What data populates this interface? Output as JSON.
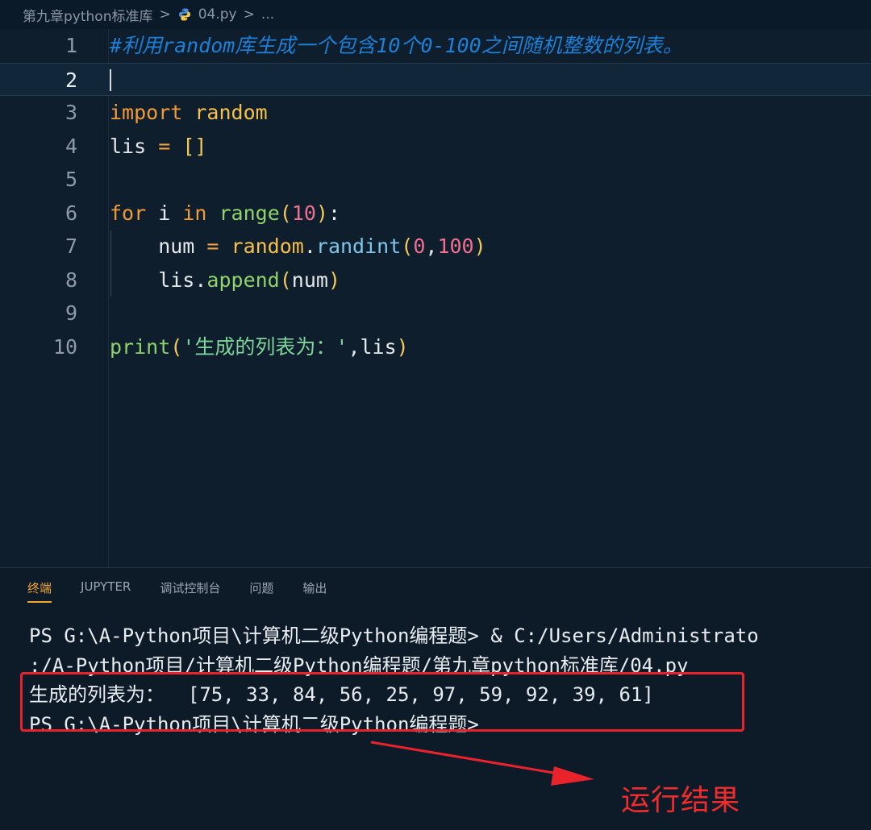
{
  "breadcrumb": {
    "folder": "第九章python标准库",
    "separator": ">",
    "file": "04.py",
    "more": "...",
    "file_icon": "python-file-icon"
  },
  "editor": {
    "current_line": 2,
    "lines": [
      {
        "number": "1",
        "tokens": [
          {
            "t": "#利用random库生成一个包含10个0-100之间随机整数的列表。",
            "c": "comment"
          }
        ]
      },
      {
        "number": "2",
        "tokens": []
      },
      {
        "number": "3",
        "tokens": [
          {
            "t": "import",
            "c": "kw"
          },
          {
            "t": " ",
            "c": "var"
          },
          {
            "t": "random",
            "c": "mod"
          }
        ]
      },
      {
        "number": "4",
        "tokens": [
          {
            "t": "lis",
            "c": "var"
          },
          {
            "t": " = ",
            "c": "op"
          },
          {
            "t": "[]",
            "c": "brk"
          }
        ]
      },
      {
        "number": "5",
        "tokens": []
      },
      {
        "number": "6",
        "tokens": [
          {
            "t": "for",
            "c": "kw"
          },
          {
            "t": " i ",
            "c": "var"
          },
          {
            "t": "in",
            "c": "kw"
          },
          {
            "t": " ",
            "c": "var"
          },
          {
            "t": "range",
            "c": "func"
          },
          {
            "t": "(",
            "c": "brk"
          },
          {
            "t": "10",
            "c": "num"
          },
          {
            "t": ")",
            "c": "brk"
          },
          {
            "t": ":",
            "c": "punc"
          }
        ]
      },
      {
        "number": "7",
        "tokens": [
          {
            "t": "    num",
            "c": "var"
          },
          {
            "t": " = ",
            "c": "op"
          },
          {
            "t": "random",
            "c": "mod"
          },
          {
            "t": ".",
            "c": "punc"
          },
          {
            "t": "randint",
            "c": "method"
          },
          {
            "t": "(",
            "c": "brk"
          },
          {
            "t": "0",
            "c": "num"
          },
          {
            "t": ",",
            "c": "punc"
          },
          {
            "t": "100",
            "c": "num"
          },
          {
            "t": ")",
            "c": "brk"
          }
        ]
      },
      {
        "number": "8",
        "tokens": [
          {
            "t": "    lis",
            "c": "var"
          },
          {
            "t": ".",
            "c": "punc"
          },
          {
            "t": "append",
            "c": "func"
          },
          {
            "t": "(",
            "c": "brk"
          },
          {
            "t": "num",
            "c": "var"
          },
          {
            "t": ")",
            "c": "brk"
          }
        ]
      },
      {
        "number": "9",
        "tokens": []
      },
      {
        "number": "10",
        "tokens": [
          {
            "t": "print",
            "c": "func"
          },
          {
            "t": "(",
            "c": "brk"
          },
          {
            "t": "'生成的列表为：'",
            "c": "str"
          },
          {
            "t": ",",
            "c": "punc"
          },
          {
            "t": "lis",
            "c": "var"
          },
          {
            "t": ")",
            "c": "brk"
          }
        ]
      }
    ]
  },
  "panel": {
    "tabs": [
      {
        "label": "终端",
        "active": true
      },
      {
        "label": "JUPYTER",
        "active": false
      },
      {
        "label": "调试控制台",
        "active": false
      },
      {
        "label": "问题",
        "active": false
      },
      {
        "label": "输出",
        "active": false
      }
    ],
    "terminal_lines": [
      "PS G:\\A-Python项目\\计算机二级Python编程题> & C:/Users/Administrato",
      ":/A-Python项目/计算机二级Python编程题/第九章python标准库/04.py",
      "生成的列表为：  [75, 33, 84, 56, 25, 97, 59, 92, 39, 61]",
      "PS G:\\A-Python项目\\计算机二级Python编程题>"
    ]
  },
  "annotation": {
    "label": "运行结果",
    "color": "#ef2b2b"
  },
  "colors": {
    "editor_bg": "#0e1e2d",
    "comment": "#1e7fd6",
    "keyword": "#f29a38",
    "string": "#7fd49a",
    "number": "#f0708f",
    "active_tab": "#f0a532"
  }
}
